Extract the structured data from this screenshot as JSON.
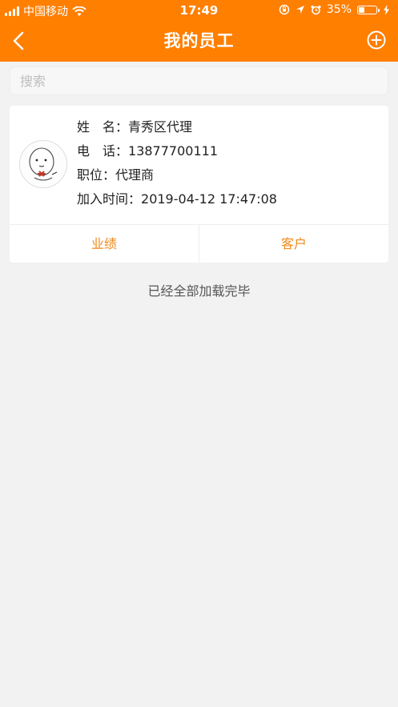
{
  "status_bar": {
    "carrier": "中国移动",
    "time": "17:49",
    "battery": "35%",
    "battery_level": 0.35
  },
  "header": {
    "title": "我的员工",
    "back_icon": "chevron-left-icon",
    "add_icon": "plus-circle-icon",
    "color": "#ff7f00"
  },
  "search": {
    "placeholder": "搜索",
    "value": ""
  },
  "employee": {
    "name_label": "姓　名：",
    "name": "青秀区代理",
    "phone_label": "电　话：",
    "phone": "13877700111",
    "position_label": "职位：",
    "position": "代理商",
    "joined_label": "加入时间：",
    "joined": "2019-04-12 17:47:08",
    "actions": {
      "performance": "业绩",
      "customers": "客户"
    }
  },
  "list_end_text": "已经全部加载完毕",
  "colors": {
    "accent": "#ff7f00",
    "tab_text": "#f08a1c",
    "background": "#f2f2f2"
  }
}
